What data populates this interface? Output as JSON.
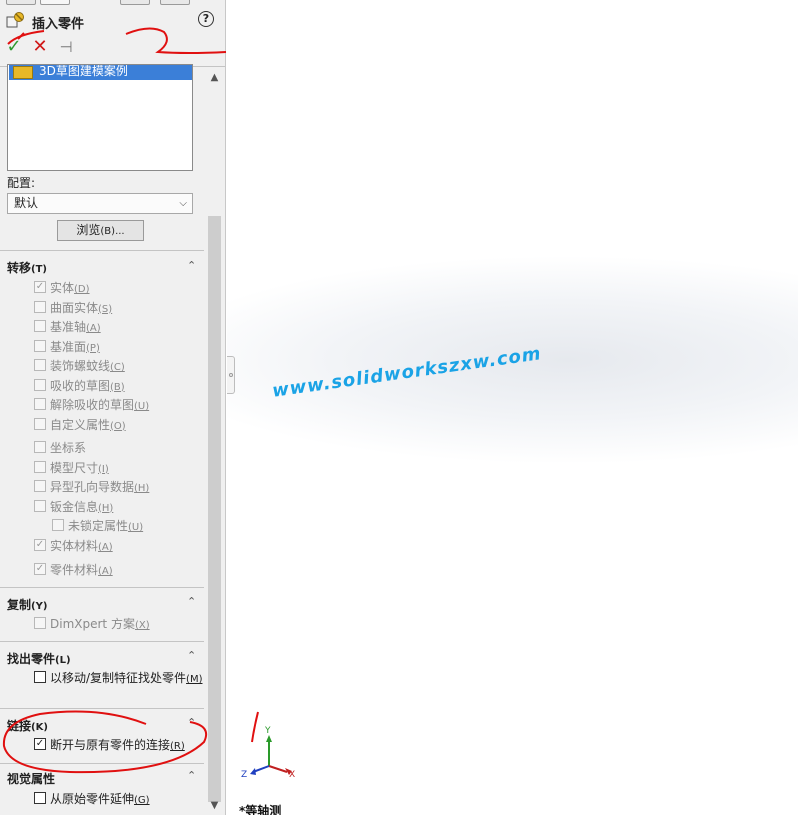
{
  "panel": {
    "title": "插入零件",
    "help": "?",
    "ok": "✓",
    "cancel": "✕",
    "pin": "⊣",
    "part_list": [
      "3D草图建模案例"
    ],
    "config_label": "配置:",
    "config_value": "默认",
    "browse_label": "浏览",
    "browse_hotkey": "(B)...",
    "scroll_up": "▲",
    "scroll_down": "▼"
  },
  "sections": {
    "transfer": {
      "title": "转移",
      "hotkey": "(T)",
      "items": [
        {
          "label": "实体",
          "hk": "(D)",
          "checked": true,
          "enabled": false
        },
        {
          "label": "曲面实体",
          "hk": "(S)",
          "checked": false,
          "enabled": false
        },
        {
          "label": "基准轴",
          "hk": "(A)",
          "checked": false,
          "enabled": false
        },
        {
          "label": "基准面",
          "hk": "(P)",
          "checked": false,
          "enabled": false
        },
        {
          "label": "装饰螺蚊线",
          "hk": "(C)",
          "checked": false,
          "enabled": false
        },
        {
          "label": "吸收的草图",
          "hk": "(B)",
          "checked": false,
          "enabled": false
        },
        {
          "label": "解除吸收的草图",
          "hk": "(U)",
          "checked": false,
          "enabled": false
        },
        {
          "label": "自定义属性",
          "hk": "(O)",
          "checked": false,
          "enabled": false
        },
        {
          "label": "坐标系",
          "hk": "",
          "checked": false,
          "enabled": false
        },
        {
          "label": "模型尺寸",
          "hk": "(I)",
          "checked": false,
          "enabled": false
        },
        {
          "label": "异型孔向导数据",
          "hk": "(H)",
          "checked": false,
          "enabled": false
        },
        {
          "label": "钣金信息",
          "hk": "(H)",
          "checked": false,
          "enabled": false
        },
        {
          "label": "未锁定属性",
          "hk": "(U)",
          "checked": false,
          "enabled": false
        },
        {
          "label": "实体材料",
          "hk": "(A)",
          "checked": true,
          "enabled": false
        },
        {
          "label": "零件材料",
          "hk": "(A)",
          "checked": true,
          "enabled": false
        }
      ]
    },
    "copy": {
      "title": "复制",
      "hotkey": "(Y)",
      "items": [
        {
          "label": "DimXpert 方案",
          "hk": "(X)",
          "checked": false,
          "enabled": false
        }
      ]
    },
    "find": {
      "title": "找出零件",
      "hotkey": "(L)",
      "items": [
        {
          "label": "以移动/复制特征找处零件",
          "hk": "(M)",
          "checked": false,
          "enabled": true
        }
      ]
    },
    "link": {
      "title": "链接",
      "hotkey": "(K)",
      "items": [
        {
          "label": "断开与原有零件的连接",
          "hk": "(R)",
          "checked": true,
          "enabled": true
        }
      ]
    },
    "visual": {
      "title": "视觉属性",
      "hotkey": "",
      "items": [
        {
          "label": "从原始零件延伸",
          "hk": "(G)",
          "checked": false,
          "enabled": true
        }
      ]
    }
  },
  "graphics": {
    "watermark": "www.solidworkszxw.com",
    "view_name": "*等轴测",
    "axes": {
      "x": "X",
      "y": "Y",
      "z": "Z"
    }
  },
  "colors": {
    "ok": "#2f9a2f",
    "cancel": "#d01818",
    "selection": "#3b7fd8",
    "watermark": "#1aa3e6",
    "annotation": "#e01010"
  }
}
